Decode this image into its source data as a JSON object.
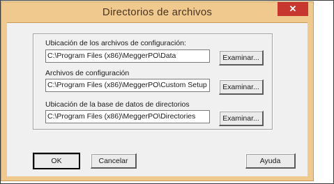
{
  "window": {
    "title": "Directorios de archivos",
    "close_glyph": "✕"
  },
  "fields": [
    {
      "label": "Ubicación de los archivos de configuración:",
      "value": "C:\\Program Files (x86)\\MeggerPO\\Data",
      "browse": "Examinar..."
    },
    {
      "label": "Archivos de configuración",
      "value": "C:\\Program Files (x86)\\MeggerPO\\Custom Setup",
      "browse": "Examinar..."
    },
    {
      "label": "Ubicación de la base de datos de directorios",
      "value": "C:\\Program Files (x86)\\MeggerPO\\Directories",
      "browse": "Examinar..."
    }
  ],
  "buttons": {
    "ok": "OK",
    "cancel": "Cancelar",
    "help": "Ayuda"
  }
}
